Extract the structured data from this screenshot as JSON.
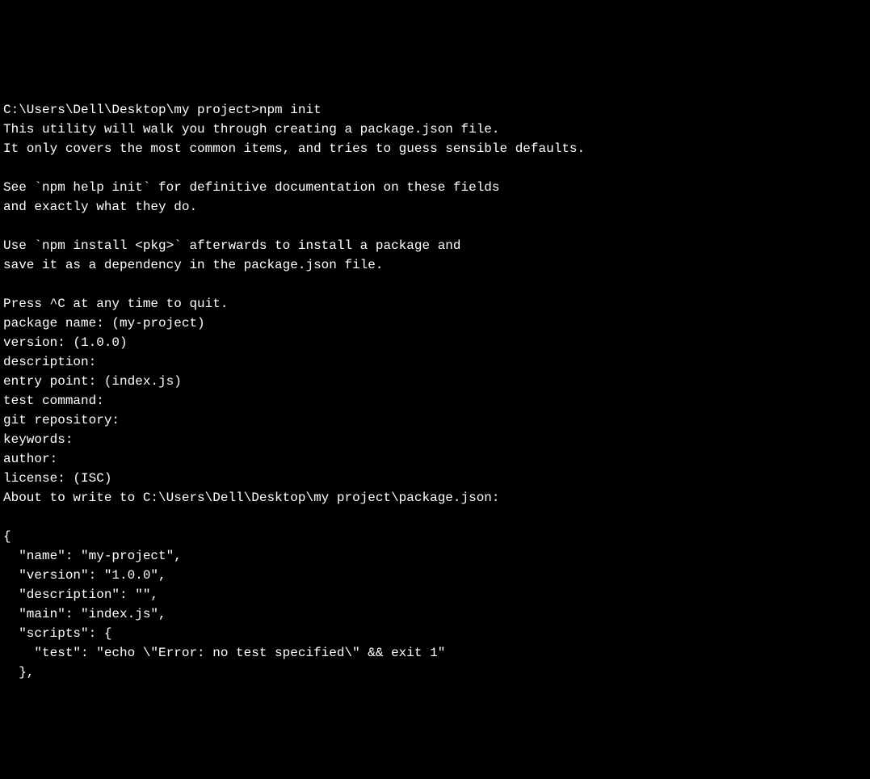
{
  "terminal": {
    "lines": {
      "l0": "",
      "l1": "C:\\Users\\Dell\\Desktop\\my project>npm init",
      "l2": "This utility will walk you through creating a package.json file.",
      "l3": "It only covers the most common items, and tries to guess sensible defaults.",
      "l4": "",
      "l5": "See `npm help init` for definitive documentation on these fields",
      "l6": "and exactly what they do.",
      "l7": "",
      "l8": "Use `npm install <pkg>` afterwards to install a package and",
      "l9": "save it as a dependency in the package.json file.",
      "l10": "",
      "l11": "Press ^C at any time to quit.",
      "l12": "package name: (my-project)",
      "l13": "version: (1.0.0)",
      "l14": "description:",
      "l15": "entry point: (index.js)",
      "l16": "test command:",
      "l17": "git repository:",
      "l18": "keywords:",
      "l19": "author:",
      "l20": "license: (ISC)",
      "l21": "About to write to C:\\Users\\Dell\\Desktop\\my project\\package.json:",
      "l22": "",
      "l23": "{",
      "l24": "  \"name\": \"my-project\",",
      "l25": "  \"version\": \"1.0.0\",",
      "l26": "  \"description\": \"\",",
      "l27": "  \"main\": \"index.js\",",
      "l28": "  \"scripts\": {",
      "l29": "    \"test\": \"echo \\\"Error: no test specified\\\" && exit 1\"",
      "l30": "  },"
    }
  }
}
